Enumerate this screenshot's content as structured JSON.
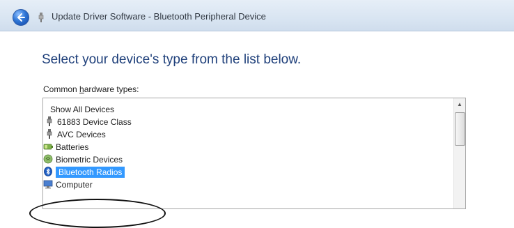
{
  "window": {
    "title": "Update Driver Software - Bluetooth Peripheral Device"
  },
  "heading": "Select your device's type from the list below.",
  "list_label_prefix": "Common ",
  "list_label_accesskey": "h",
  "list_label_suffix": "ardware types:",
  "items": [
    {
      "label": "Show All Devices",
      "icon": "none"
    },
    {
      "label": "61883 Device Class",
      "icon": "plug-icon"
    },
    {
      "label": "AVC Devices",
      "icon": "plug-icon"
    },
    {
      "label": "Batteries",
      "icon": "battery-icon"
    },
    {
      "label": "Biometric Devices",
      "icon": "biometric-icon"
    },
    {
      "label": "Bluetooth Radios",
      "icon": "bluetooth-icon",
      "selected": true
    },
    {
      "label": "Computer",
      "icon": "computer-icon"
    }
  ],
  "colors": {
    "selection": "#3399ff",
    "heading": "#1e3f7a"
  }
}
